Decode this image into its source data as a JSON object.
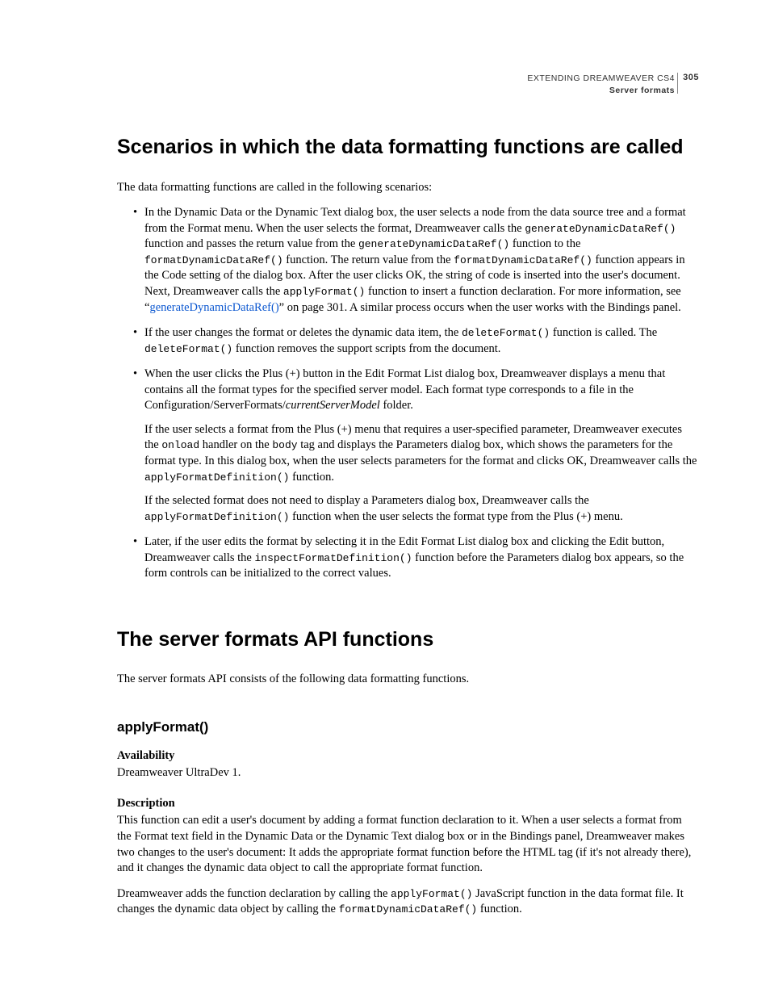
{
  "header": {
    "doc_title": "EXTENDING DREAMWEAVER CS4",
    "section": "Server formats",
    "page_number": "305"
  },
  "h1_scenarios": "Scenarios in which the data formatting functions are called",
  "intro_scenarios": "The data formatting functions are called in the following scenarios:",
  "bullets": {
    "b1": {
      "t1": "In the Dynamic Data or the Dynamic Text dialog box, the user selects a node from the data source tree and a format from the Format menu. When the user selects the format, Dreamweaver calls the ",
      "c1": "generateDynamicDataRef()",
      "t2": " function and passes the return value from the ",
      "c2": "generateDynamicDataRef()",
      "t3": " function to the ",
      "c3": "formatDynamicDataRef()",
      "t4": " function. The return value from the ",
      "c4": "formatDynamicDataRef()",
      "t5": " function appears in the Code setting of the dialog box. After the user clicks OK, the string of code is inserted into the user's document. Next, Dreamweaver calls the ",
      "c5": "applyFormat()",
      "t6": " function to insert a function declaration. For more information, see “",
      "link": "generateDynamicDataRef()",
      "t7": "” on page 301. A similar process occurs when the user works with the Bindings panel."
    },
    "b2": {
      "t1": "If the user changes the format or deletes the dynamic data item, the ",
      "c1": "deleteFormat()",
      "t2": " function is called. The ",
      "c2": "deleteFormat()",
      "t3": " function removes the support scripts from the document."
    },
    "b3": {
      "p1a": "When the user clicks the Plus (+) button in the Edit Format List dialog box, Dreamweaver displays a menu that contains all the format types for the specified server model. Each format type corresponds to a file in the Configuration/ServerFormats/",
      "p1i": "currentServerModel",
      "p1b": " folder.",
      "p2a": "If the user selects a format from the Plus (+) menu that requires a user-specified parameter, Dreamweaver executes the ",
      "p2c1": "onload",
      "p2b": " handler on the ",
      "p2c2": "body",
      "p2c": " tag and displays the Parameters dialog box, which shows the parameters for the format type. In this dialog box, when the user selects parameters for the format and clicks OK, Dreamweaver calls the ",
      "p2c3": "applyFormatDefinition()",
      "p2d": " function.",
      "p3a": "If the selected format does not need to display a Parameters dialog box, Dreamweaver calls the ",
      "p3c1": "applyFormatDefinition()",
      "p3b": " function when the user selects the format type from the Plus (+) menu."
    },
    "b4": {
      "t1": "Later, if the user edits the format by selecting it in the Edit Format List dialog box and clicking the Edit button, Dreamweaver calls the ",
      "c1": "inspectFormatDefinition()",
      "t2": " function before the Parameters dialog box appears, so the form controls can be initialized to the correct values."
    }
  },
  "h1_api": "The server formats API functions",
  "intro_api": "The server formats API consists of the following data formatting functions.",
  "h2_applyformat": "applyFormat()",
  "avail_label": "Availability",
  "avail_value": "Dreamweaver UltraDev 1.",
  "desc_label": "Description",
  "desc_p1": "This function can edit a user's document by adding a format function declaration to it. When a user selects a format from the Format text field in the Dynamic Data or the Dynamic Text dialog box or in the Bindings panel, Dreamweaver makes two changes to the user's document: It adds the appropriate format function before the HTML tag (if it's not already there), and it changes the dynamic data object to call the appropriate format function.",
  "desc_p2": {
    "t1": "Dreamweaver adds the function declaration by calling the ",
    "c1": "applyFormat()",
    "t2": " JavaScript function in the data format file. It changes the dynamic data object by calling the ",
    "c2": "formatDynamicDataRef()",
    "t3": " function."
  }
}
